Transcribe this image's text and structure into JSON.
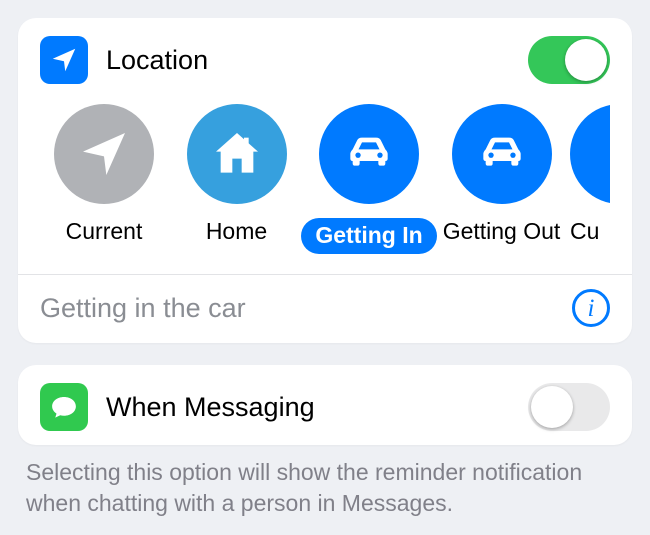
{
  "location": {
    "title": "Location",
    "enabled": true,
    "options": [
      {
        "key": "current",
        "label": "Current",
        "color": "#b0b2b6",
        "icon": "navigate"
      },
      {
        "key": "home",
        "label": "Home",
        "color": "#36a0de",
        "icon": "home"
      },
      {
        "key": "getting-in",
        "label": "Getting In",
        "color": "#007aff",
        "icon": "car",
        "selected": true
      },
      {
        "key": "getting-out",
        "label": "Getting Out",
        "color": "#007aff",
        "icon": "car"
      },
      {
        "key": "custom",
        "label": "Cu",
        "color": "#007aff",
        "icon": "",
        "partial": true
      }
    ],
    "detail_text": "Getting in the car"
  },
  "messaging": {
    "title": "When Messaging",
    "enabled": false,
    "hint": "Selecting this option will show the reminder notification when chatting with a person in Messages."
  },
  "colors": {
    "accent_blue": "#007aff",
    "toggle_green": "#34c759",
    "messaging_green": "#30c94f",
    "gray": "#808089"
  }
}
